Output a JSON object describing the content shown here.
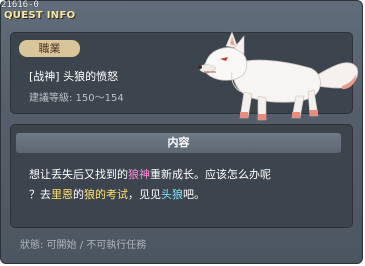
{
  "quest_id": "21616-0",
  "window_title": "QUEST INFO",
  "job_badge": "職業",
  "quest_name": "[战神] 头狼的愤怒",
  "quest_level": "建議等級: 150～154",
  "content_header": "内容",
  "content": {
    "line1_a": "想让丢失后又找到的",
    "line1_hl": "狼神",
    "line1_b": "重新成长。应该怎么办呢",
    "line2_a": "？去",
    "line2_hl1": "里恩",
    "line2_b": "的",
    "line2_hl2": "狼的考试",
    "line2_c": "，见见",
    "line2_hl3": "头狼",
    "line2_d": "吧。"
  },
  "status_text": "狀態: 可開始 / 不可執行任務",
  "colors": {
    "window_bg": "#545f6b",
    "panel_bg": "#3c444d",
    "title": "#f7e7a0",
    "badge": "#d8c59a",
    "highlight_pink": "#ff8ad9",
    "highlight_yellow": "#ffe36a",
    "highlight_cyan": "#7ee6ff"
  },
  "icons": {
    "wolf": "white-wolf-illustration"
  }
}
